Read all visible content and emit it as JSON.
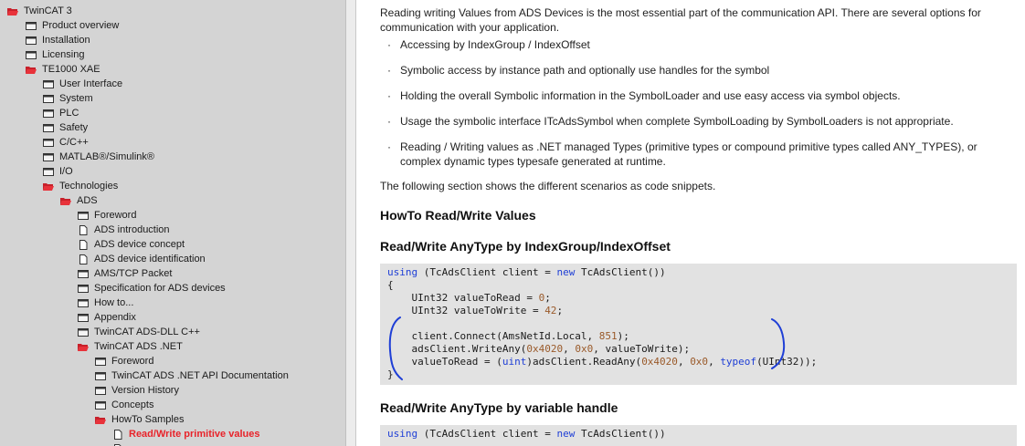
{
  "sidebar": {
    "items": [
      {
        "label": "TwinCAT 3",
        "icon": "open-folder-icon"
      },
      {
        "label": "Product overview",
        "icon": "book-icon"
      },
      {
        "label": "Installation",
        "icon": "book-icon"
      },
      {
        "label": "Licensing",
        "icon": "book-icon"
      },
      {
        "label": "TE1000 XAE",
        "icon": "open-folder-icon"
      },
      {
        "label": "User Interface",
        "icon": "book-icon"
      },
      {
        "label": "System",
        "icon": "book-icon"
      },
      {
        "label": "PLC",
        "icon": "book-icon"
      },
      {
        "label": "Safety",
        "icon": "book-icon"
      },
      {
        "label": "C/C++",
        "icon": "book-icon"
      },
      {
        "label": "MATLAB®/Simulink®",
        "icon": "book-icon"
      },
      {
        "label": "I/O",
        "icon": "book-icon"
      },
      {
        "label": "Technologies",
        "icon": "open-folder-icon"
      },
      {
        "label": "ADS",
        "icon": "open-folder-icon"
      },
      {
        "label": "Foreword",
        "icon": "book-icon"
      },
      {
        "label": "ADS introduction",
        "icon": "page-icon"
      },
      {
        "label": "ADS device concept",
        "icon": "page-icon"
      },
      {
        "label": "ADS device identification",
        "icon": "page-icon"
      },
      {
        "label": "AMS/TCP Packet",
        "icon": "book-icon"
      },
      {
        "label": "Specification for ADS devices",
        "icon": "book-icon"
      },
      {
        "label": "How to...",
        "icon": "book-icon"
      },
      {
        "label": "Appendix",
        "icon": "book-icon"
      },
      {
        "label": "TwinCAT ADS-DLL C++",
        "icon": "book-icon"
      },
      {
        "label": "TwinCAT ADS .NET",
        "icon": "open-folder-icon"
      },
      {
        "label": "Foreword",
        "icon": "book-icon"
      },
      {
        "label": "TwinCAT ADS .NET API Documentation",
        "icon": "book-icon"
      },
      {
        "label": "Version History",
        "icon": "book-icon"
      },
      {
        "label": "Concepts",
        "icon": "book-icon"
      },
      {
        "label": "HowTo Samples",
        "icon": "open-folder-icon"
      },
      {
        "label": "Read/Write primitive values",
        "icon": "page-icon"
      }
    ]
  },
  "content": {
    "intro": "Reading writing Values from ADS Devices is the most essential part of the communication API. There are several options for communication with your application.",
    "bullets": [
      "Accessing by IndexGroup / IndexOffset",
      "Symbolic access by instance path and optionally use handles for the symbol",
      "Holding the overall Symbolic information in the SymbolLoader and use easy access via symbol objects.",
      "Usage the symbolic interface ITcAdsSymbol when complete SymbolLoading by SymbolLoaders is not appropriate.",
      "Reading / Writing values as .NET managed Types (primitive types or compound primitive types called ANY_TYPES), or complex dynamic types typesafe generated at runtime."
    ],
    "following": "The following section shows the different scenarios as code snippets.",
    "heading_main": "HowTo Read/Write Values",
    "heading_1": "Read/Write AnyType by IndexGroup/IndexOffset",
    "heading_2": "Read/Write AnyType by variable handle",
    "code_1": {
      "l1_kw": "using",
      "l1_a": " (TcAdsClient client = ",
      "l1_kw2": "new",
      "l1_b": " TcAdsClient())",
      "l2": "{",
      "l3_a": "    UInt32 valueToRead = ",
      "l3_num": "0",
      "l3_b": ";",
      "l4_a": "    UInt32 valueToWrite = ",
      "l4_num": "42",
      "l4_b": ";",
      "l5": "",
      "l6_a": "    client.Connect(AmsNetId.Local, ",
      "l6_num": "851",
      "l6_b": ");",
      "l7_a": "    adsClient.WriteAny(",
      "l7_n1": "0x4020",
      "l7_s": ", ",
      "l7_n2": "0x0",
      "l7_b": ", valueToWrite);",
      "l8_a": "    valueToRead = (",
      "l8_kw": "uint",
      "l8_b": ")adsClient.ReadAny(",
      "l8_n1": "0x4020",
      "l8_s": ", ",
      "l8_n2": "0x0",
      "l8_s2": ", ",
      "l8_kw2": "typeof",
      "l8_c": "(UInt32));",
      "l9": "}"
    },
    "code_2": {
      "l1_kw": "using",
      "l1_a": " (TcAdsClient client = ",
      "l1_kw2": "new",
      "l1_b": " TcAdsClient())"
    }
  },
  "colors": {
    "active_item": "#e8232a",
    "keyword": "#1f3fd6",
    "annotation": "#1f3fd6",
    "sidebar_bg": "#d4d4d4",
    "code_bg": "#e2e2e2"
  }
}
